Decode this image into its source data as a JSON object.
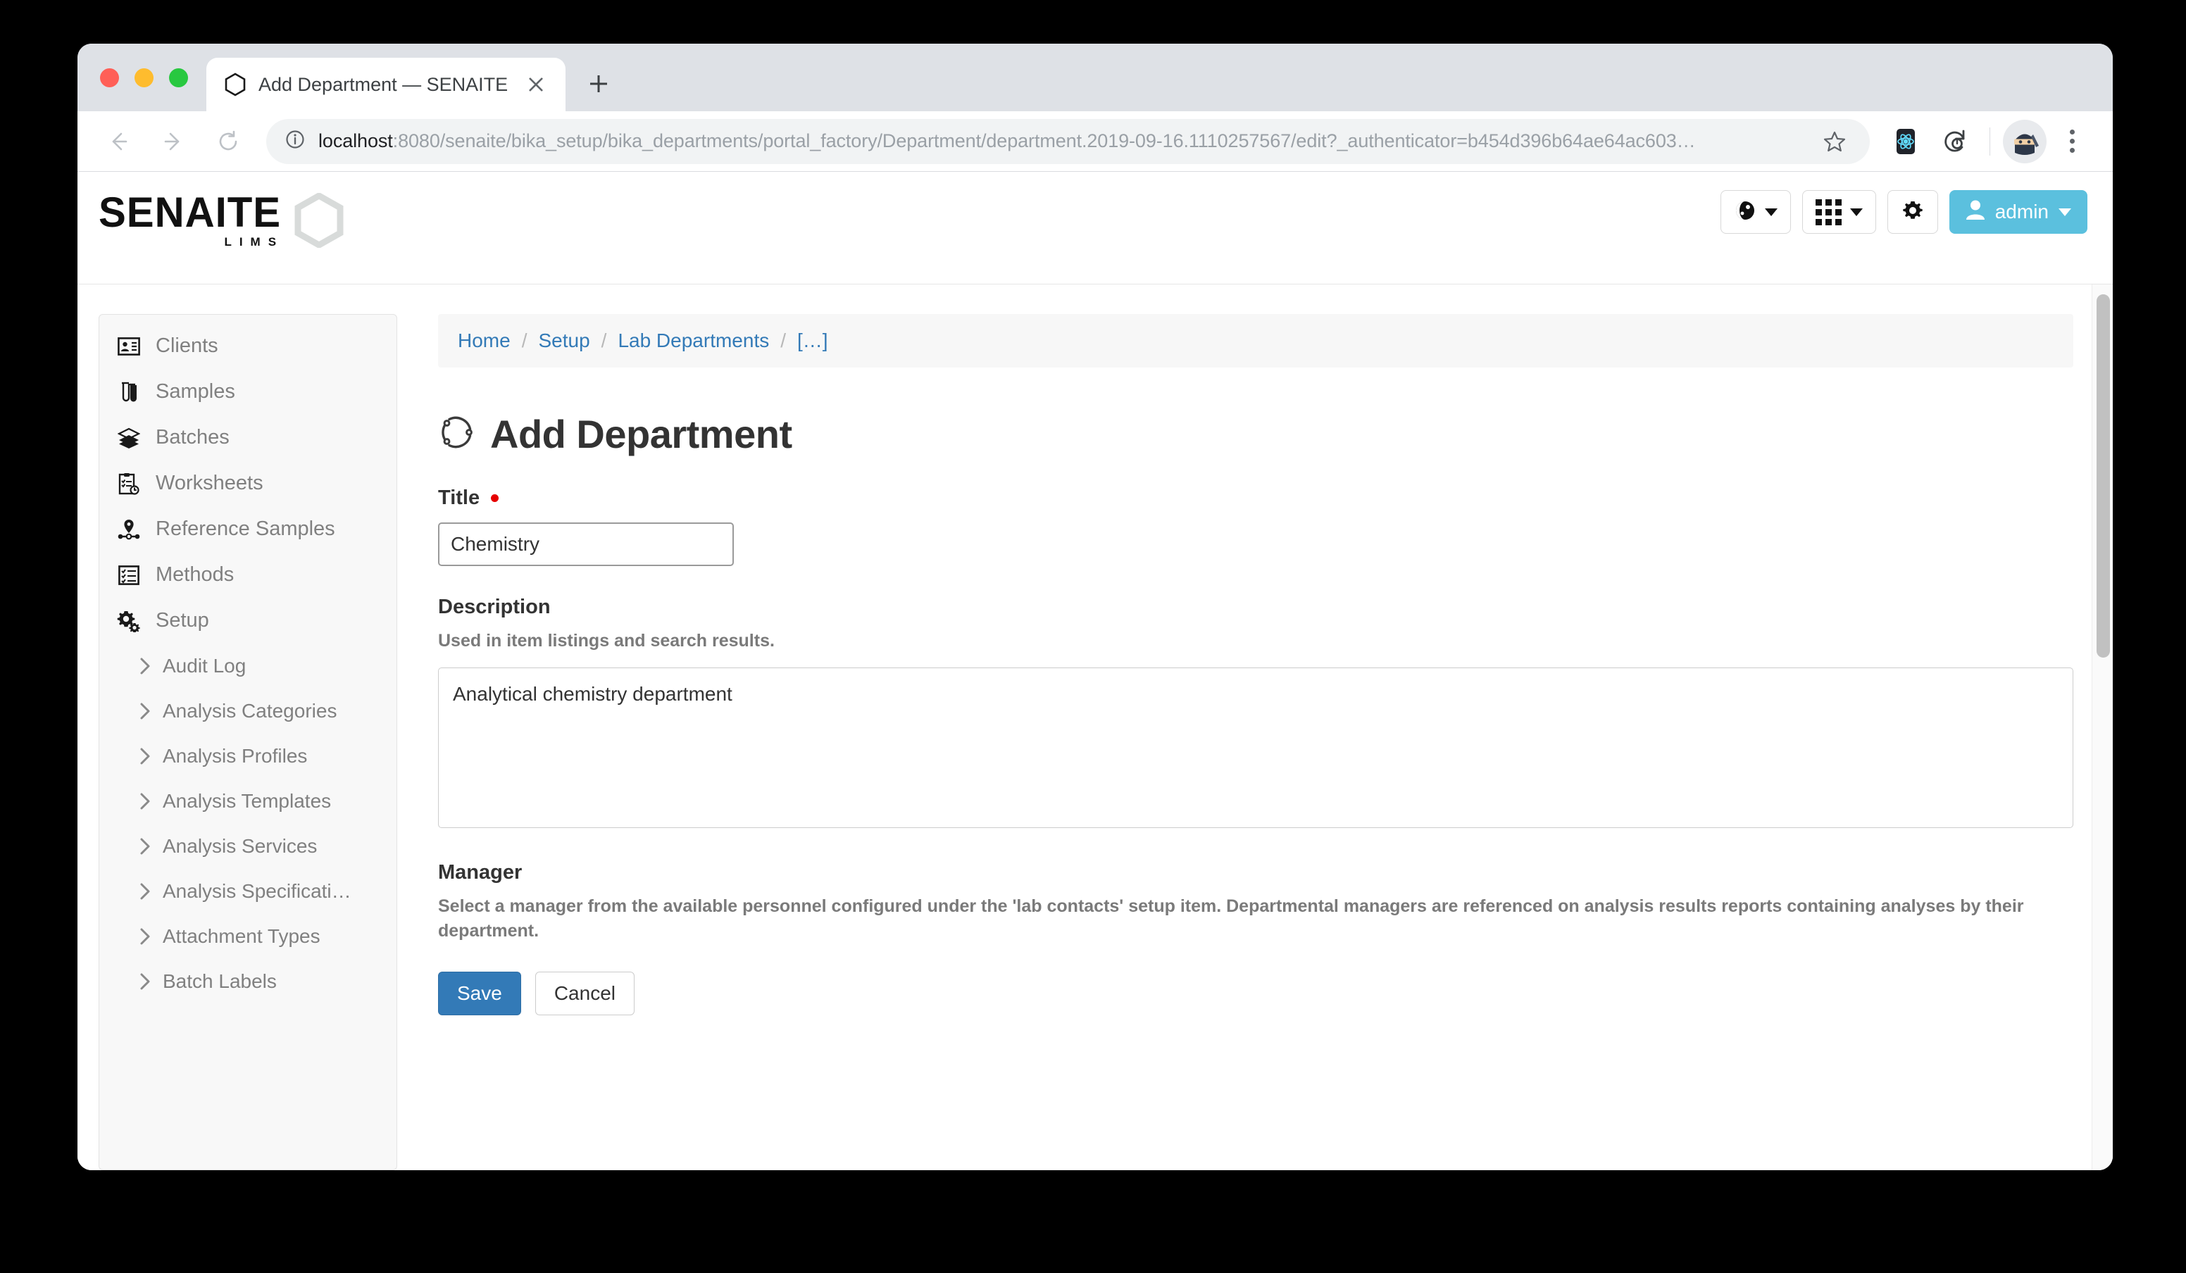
{
  "browser": {
    "tab": {
      "title": "Add Department — SENAITE",
      "favicon_icon": "hexagon-icon",
      "close_icon": "close-icon"
    },
    "new_tab_icon": "plus-icon",
    "back_icon": "arrow-left-icon",
    "forward_icon": "arrow-right-icon",
    "reload_icon": "reload-icon",
    "omnibox": {
      "info_icon": "info-circle-icon",
      "host": "localhost",
      "path": ":8080/senaite/bika_setup/bika_departments/portal_factory/Department/department.2019-09-16.1110257567/edit?_authenticator=b454d396b64ae64ac603…",
      "star_icon": "star-icon"
    },
    "extensions": [
      {
        "name": "react-devtools-icon"
      },
      {
        "name": "refresh-sync-icon"
      }
    ],
    "profile_icon": "ninja-avatar-icon",
    "menu_icon": "kebab-menu-icon"
  },
  "app_header": {
    "logo_word": "SENAITE",
    "logo_sub": "LIMS",
    "logo_hex_icon": "hexagon-outline-icon",
    "actions": [
      {
        "name": "language-selector",
        "icon": "globe-icon",
        "label": ""
      },
      {
        "name": "apps-selector",
        "icon": "grid-icon",
        "label": ""
      },
      {
        "name": "settings-button",
        "icon": "gear-icon",
        "label": ""
      },
      {
        "name": "user-menu",
        "icon": "user-icon",
        "label": "admin"
      }
    ]
  },
  "sidebar": {
    "items": [
      {
        "label": "Clients",
        "icon": "id-card-icon"
      },
      {
        "label": "Samples",
        "icon": "test-tube-icon"
      },
      {
        "label": "Batches",
        "icon": "layers-icon"
      },
      {
        "label": "Worksheets",
        "icon": "clipboard-clock-icon"
      },
      {
        "label": "Reference Samples",
        "icon": "map-pin-icon"
      },
      {
        "label": "Methods",
        "icon": "checklist-icon"
      },
      {
        "label": "Setup",
        "icon": "cogs-icon"
      }
    ],
    "sub_items": [
      {
        "label": "Audit Log",
        "icon": "chevron-right-icon"
      },
      {
        "label": "Analysis Categories",
        "icon": "chevron-right-icon"
      },
      {
        "label": "Analysis Profiles",
        "icon": "chevron-right-icon"
      },
      {
        "label": "Analysis Templates",
        "icon": "chevron-right-icon"
      },
      {
        "label": "Analysis Services",
        "icon": "chevron-right-icon"
      },
      {
        "label": "Analysis Specificati…",
        "icon": "chevron-right-icon"
      },
      {
        "label": "Attachment Types",
        "icon": "chevron-right-icon"
      },
      {
        "label": "Batch Labels",
        "icon": "chevron-right-icon"
      }
    ]
  },
  "breadcrumb": {
    "items": [
      {
        "label": "Home"
      },
      {
        "label": "Setup"
      },
      {
        "label": "Lab Departments"
      },
      {
        "label": "[…]"
      }
    ],
    "separator": "/"
  },
  "page": {
    "title": "Add Department",
    "title_icon": "loading-spinner-icon",
    "fields": {
      "title": {
        "label": "Title",
        "required_marker": "•",
        "value": "Chemistry",
        "placeholder": ""
      },
      "description": {
        "label": "Description",
        "help": "Used in item listings and search results.",
        "value": "Analytical chemistry department",
        "placeholder": ""
      },
      "manager": {
        "label": "Manager",
        "help": "Select a manager from the available personnel configured under the 'lab contacts' setup item. Departmental managers are referenced on analysis results reports containing analyses by their department."
      }
    },
    "actions": {
      "save_label": "Save",
      "cancel_label": "Cancel"
    }
  },
  "colors": {
    "primary_button": "#337ab7",
    "user_button": "#5bc0de",
    "link": "#337ab7",
    "required": "#e60000"
  }
}
